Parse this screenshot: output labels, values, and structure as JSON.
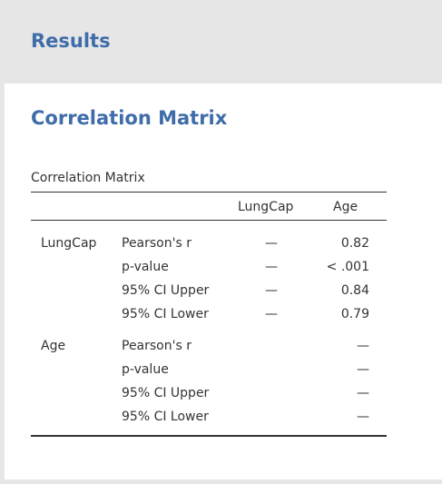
{
  "header": {
    "title": "Results"
  },
  "section": {
    "title": "Correlation Matrix"
  },
  "table": {
    "caption": "Correlation Matrix",
    "columns": [
      "LungCap",
      "Age"
    ],
    "rows": [
      {
        "variable": "LungCap",
        "stats": [
          {
            "label": "Pearson's r",
            "lungcap": "—",
            "age": "0.82"
          },
          {
            "label": "p-value",
            "lungcap": "—",
            "age": "< .001"
          },
          {
            "label": "95% CI Upper",
            "lungcap": "—",
            "age": "0.84"
          },
          {
            "label": "95% CI Lower",
            "lungcap": "—",
            "age": "0.79"
          }
        ]
      },
      {
        "variable": "Age",
        "stats": [
          {
            "label": "Pearson's r",
            "lungcap": "",
            "age": "—"
          },
          {
            "label": "p-value",
            "lungcap": "",
            "age": "—"
          },
          {
            "label": "95% CI Upper",
            "lungcap": "",
            "age": "—"
          },
          {
            "label": "95% CI Lower",
            "lungcap": "",
            "age": "—"
          }
        ]
      }
    ]
  },
  "colors": {
    "heading": "#3e6da9",
    "header_bg": "#e6e6e6",
    "text": "#333333"
  }
}
